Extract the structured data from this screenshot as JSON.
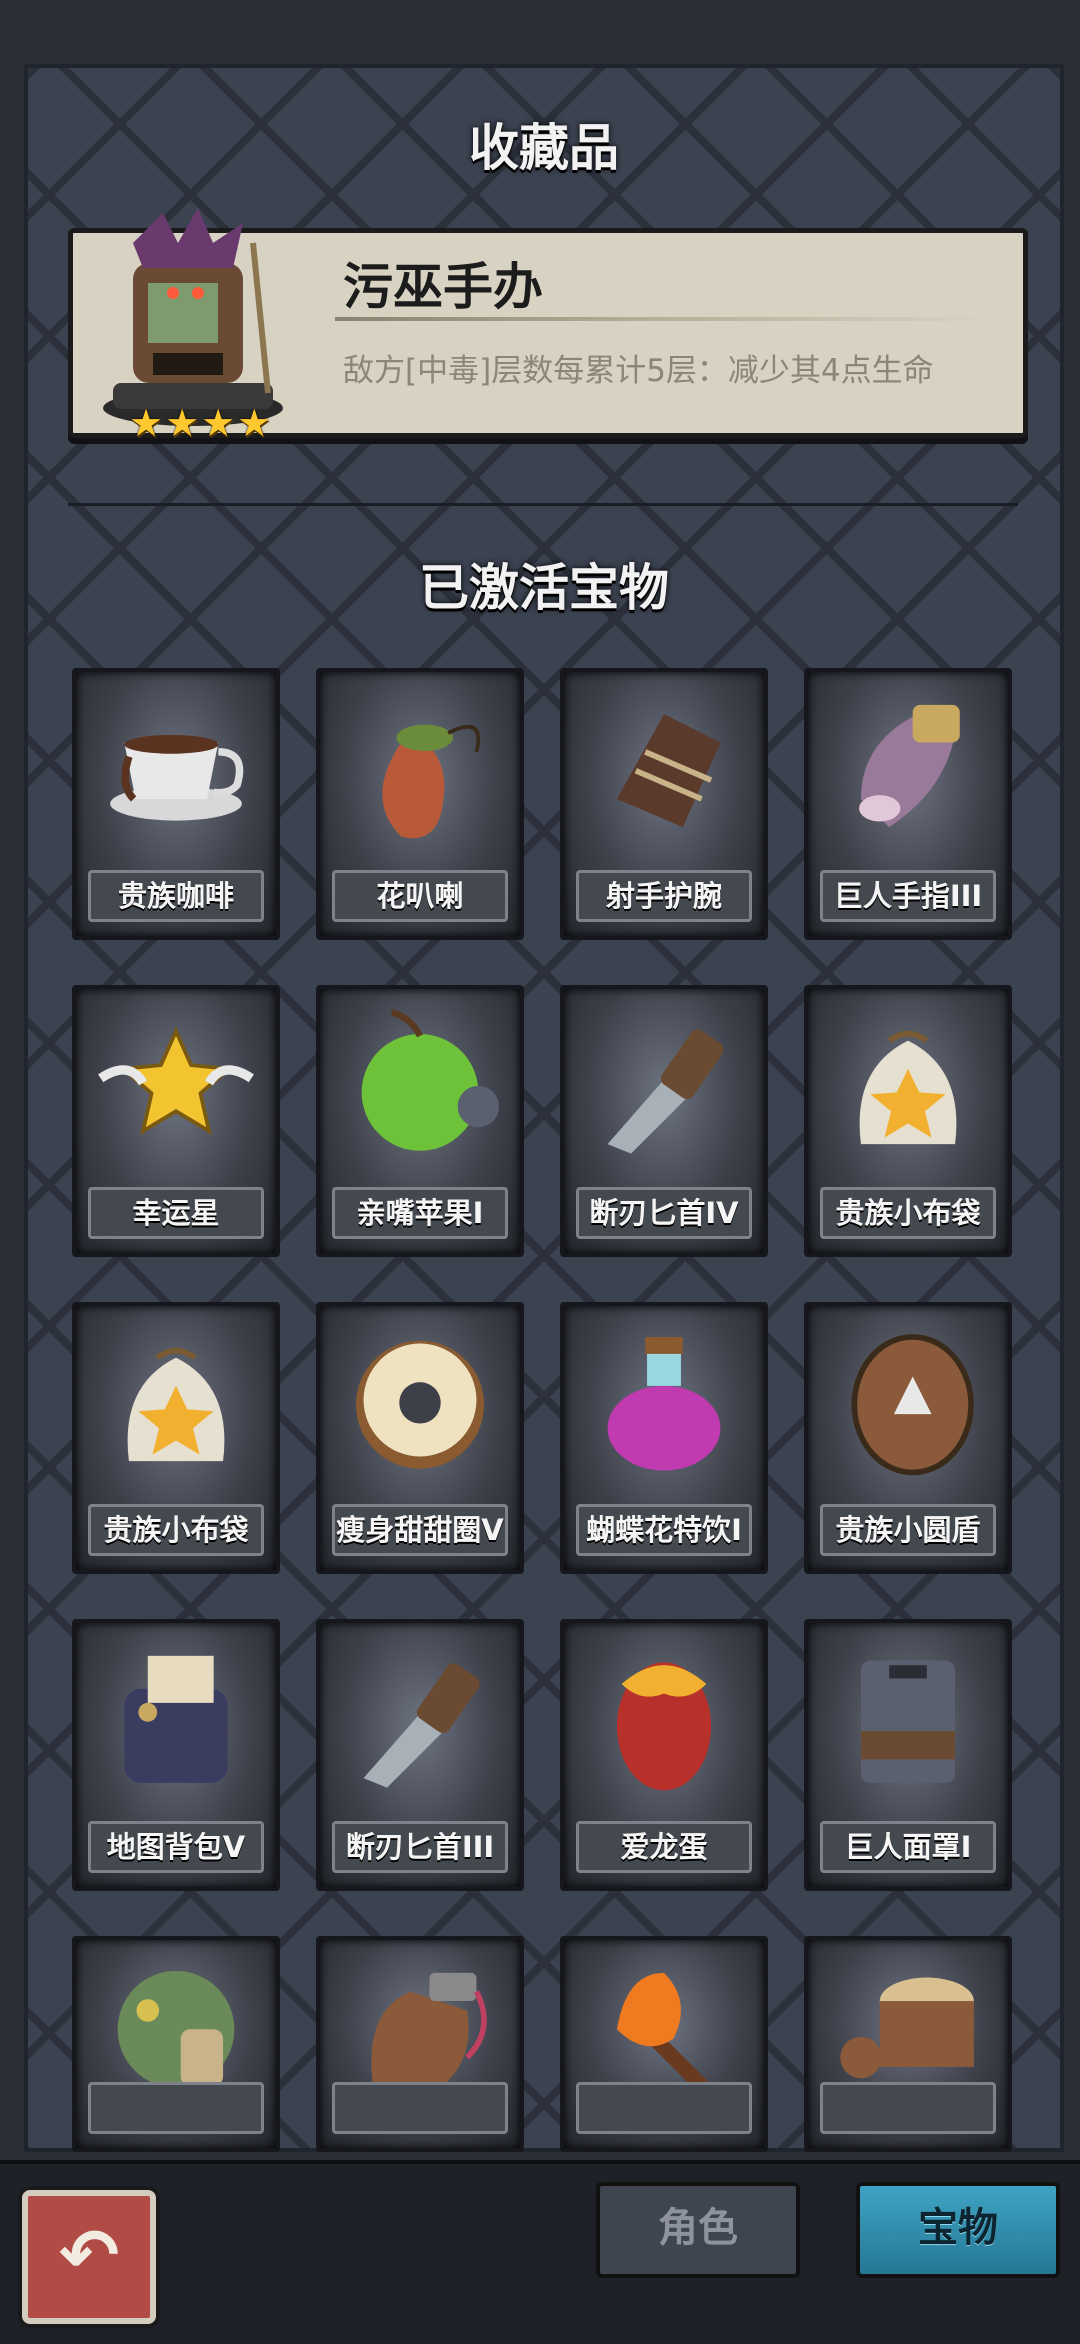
{
  "collectible": {
    "section_title": "收藏品",
    "name": "污巫手办",
    "description": "敌方[中毒]层数每累计5层：减少其4点生命",
    "stars": [
      "★",
      "★",
      "★",
      "★"
    ]
  },
  "treasures": {
    "section_title": "已激活宝物",
    "items": [
      {
        "label": "贵族咖啡",
        "icon": "coffee-cup-icon"
      },
      {
        "label": "花叭喇",
        "icon": "pitcher-plant-icon"
      },
      {
        "label": "射手护腕",
        "icon": "archer-bracer-icon"
      },
      {
        "label": "巨人手指III",
        "icon": "giant-finger-icon"
      },
      {
        "label": "幸运星",
        "icon": "lucky-star-icon"
      },
      {
        "label": "亲嘴苹果I",
        "icon": "bitten-apple-icon"
      },
      {
        "label": "断刃匕首IV",
        "icon": "broken-dagger-icon"
      },
      {
        "label": "贵族小布袋",
        "icon": "cloth-pouch-icon"
      },
      {
        "label": "贵族小布袋",
        "icon": "cloth-pouch-icon"
      },
      {
        "label": "瘦身甜甜圈V",
        "icon": "donut-icon"
      },
      {
        "label": "蝴蝶花特饮I",
        "icon": "potion-icon"
      },
      {
        "label": "贵族小圆盾",
        "icon": "round-shield-icon"
      },
      {
        "label": "地图背包V",
        "icon": "map-backpack-icon"
      },
      {
        "label": "断刃匕首III",
        "icon": "broken-dagger-icon"
      },
      {
        "label": "爱龙蛋",
        "icon": "dragon-egg-icon"
      },
      {
        "label": "巨人面罩I",
        "icon": "giant-mask-icon"
      },
      {
        "label": "",
        "icon": "mushroom-icon"
      },
      {
        "label": "",
        "icon": "leather-glove-icon"
      },
      {
        "label": "",
        "icon": "torch-icon"
      },
      {
        "label": "",
        "icon": "wood-stump-icon"
      }
    ]
  },
  "bottom_bar": {
    "tab_role": "角色",
    "tab_treasure": "宝物",
    "back_icon": "back-arrow-icon"
  }
}
